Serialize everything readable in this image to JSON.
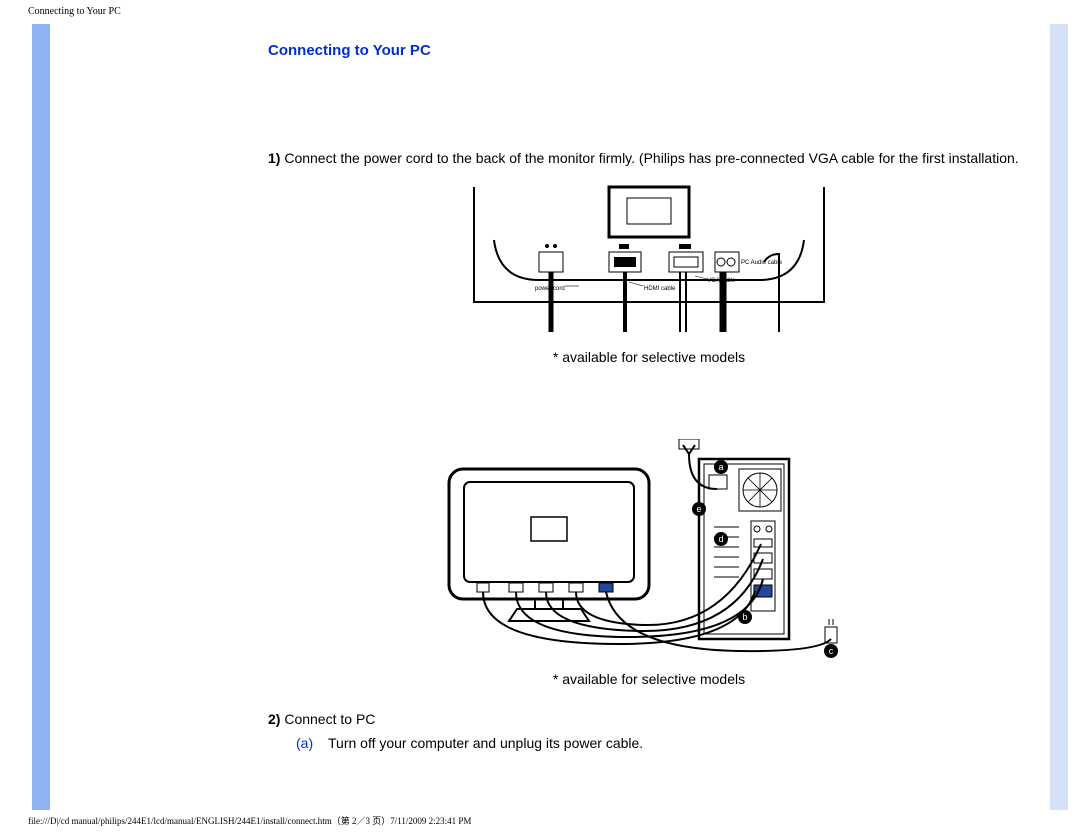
{
  "header": {
    "title": "Connecting to Your PC"
  },
  "section": {
    "heading": "Connecting to Your PC"
  },
  "step1": {
    "number": "1)",
    "text": " Connect the power cord to the back of the monitor firmly. (Philips has pre-connected VGA cable for the first installation."
  },
  "figure1": {
    "caption": "* available for selective models",
    "labels": {
      "power_cord": "power cord",
      "hdmi_cable": "HDMI cable",
      "vga_cable": "VGA cable",
      "pc_audio": "PC Audio cable"
    }
  },
  "figure2": {
    "caption": "* available for selective models",
    "markers": {
      "a": "a",
      "b": "b",
      "c": "c",
      "d": "d",
      "e": "e"
    }
  },
  "step2": {
    "number": "2)",
    "text": " Connect to PC",
    "sub_a_letter": "(a)",
    "sub_a_text": "Turn off your computer and unplug its power cable."
  },
  "footer": {
    "path": "file:///D|/cd manual/philips/244E1/lcd/manual/ENGLISH/244E1/install/connect.htm（第 2／3 页）7/11/2009 2:23:41 PM"
  }
}
